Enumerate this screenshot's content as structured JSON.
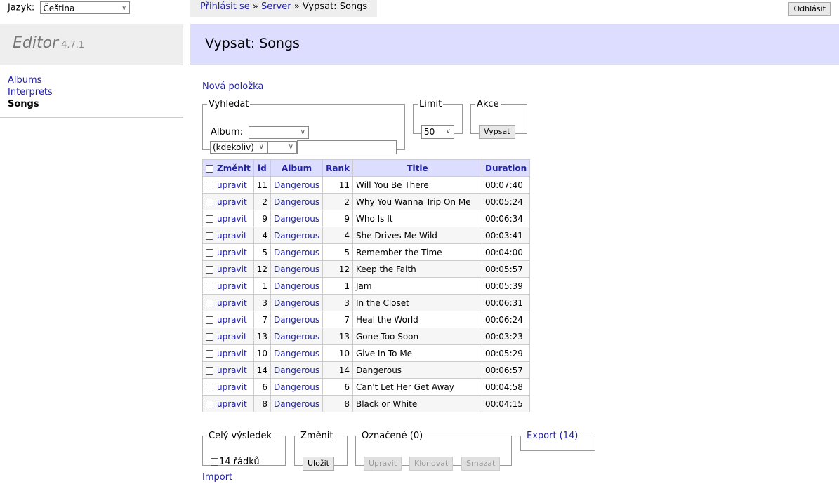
{
  "language": {
    "label": "Jazyk:",
    "selected": "Čeština"
  },
  "editor": {
    "name": "Editor",
    "version": "4.7.1"
  },
  "menu": [
    {
      "label": "Albums",
      "active": false
    },
    {
      "label": "Interprets",
      "active": false
    },
    {
      "label": "Songs",
      "active": true
    }
  ],
  "breadcrumb": {
    "login": "Přihlásit se",
    "sep1": " » ",
    "server": "Server",
    "sep2": " » ",
    "current": "Vypsat: Songs"
  },
  "logout_label": "Odhlásit",
  "page_title": "Vypsat: Songs",
  "new_item_label": "Nová položka",
  "search": {
    "legend": "Vyhledat",
    "album_label": "Album:",
    "album_value": "",
    "operator_value": "(kdekoliv)",
    "comparator_value": "",
    "text_value": ""
  },
  "limit": {
    "legend": "Limit",
    "value": "50"
  },
  "action": {
    "legend": "Akce",
    "button": "Vypsat"
  },
  "table": {
    "header_select": "Změnit",
    "columns": [
      "id",
      "Album",
      "Rank",
      "Title",
      "Duration"
    ],
    "edit_label": "upravit",
    "rows": [
      {
        "id": "11",
        "album": "Dangerous",
        "rank": "11",
        "title": "Will You Be There",
        "duration": "00:07:40"
      },
      {
        "id": "2",
        "album": "Dangerous",
        "rank": "2",
        "title": "Why You Wanna Trip On Me",
        "duration": "00:05:24"
      },
      {
        "id": "9",
        "album": "Dangerous",
        "rank": "9",
        "title": "Who Is It",
        "duration": "00:06:34"
      },
      {
        "id": "4",
        "album": "Dangerous",
        "rank": "4",
        "title": "She Drives Me Wild",
        "duration": "00:03:41"
      },
      {
        "id": "5",
        "album": "Dangerous",
        "rank": "5",
        "title": "Remember the Time",
        "duration": "00:04:00"
      },
      {
        "id": "12",
        "album": "Dangerous",
        "rank": "12",
        "title": "Keep the Faith",
        "duration": "00:05:57"
      },
      {
        "id": "1",
        "album": "Dangerous",
        "rank": "1",
        "title": "Jam",
        "duration": "00:05:39"
      },
      {
        "id": "3",
        "album": "Dangerous",
        "rank": "3",
        "title": "In the Closet",
        "duration": "00:06:31"
      },
      {
        "id": "7",
        "album": "Dangerous",
        "rank": "7",
        "title": "Heal the World",
        "duration": "00:06:24"
      },
      {
        "id": "13",
        "album": "Dangerous",
        "rank": "13",
        "title": "Gone Too Soon",
        "duration": "00:03:23"
      },
      {
        "id": "10",
        "album": "Dangerous",
        "rank": "10",
        "title": "Give In To Me",
        "duration": "00:05:29"
      },
      {
        "id": "14",
        "album": "Dangerous",
        "rank": "14",
        "title": "Dangerous",
        "duration": "00:06:57"
      },
      {
        "id": "6",
        "album": "Dangerous",
        "rank": "6",
        "title": "Can't Let Her Get Away",
        "duration": "00:04:58"
      },
      {
        "id": "8",
        "album": "Dangerous",
        "rank": "8",
        "title": "Black or White",
        "duration": "00:04:15"
      }
    ]
  },
  "whole_result": {
    "legend": "Celý výsledek",
    "rows_label": "14 řádků"
  },
  "modify": {
    "legend": "Změnit",
    "save": "Uložit"
  },
  "selected": {
    "legend": "Označené (0)",
    "edit": "Upravit",
    "clone": "Klonovat",
    "delete": "Smazat"
  },
  "export": {
    "legend": "Export (14)"
  },
  "import_label": "Import"
}
